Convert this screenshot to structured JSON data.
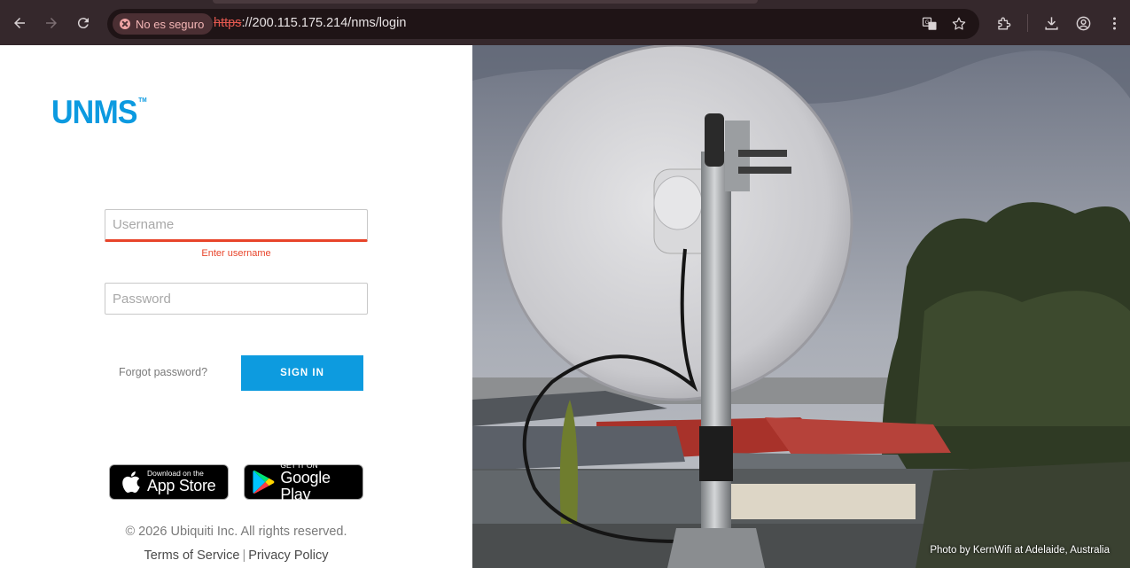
{
  "browser": {
    "security_chip": "No es seguro",
    "url_scheme": "https",
    "url_rest": "://200.115.175.214/nms/login"
  },
  "login": {
    "logo": "UNMS",
    "logo_tm": "TM",
    "username_placeholder": "Username",
    "username_error": "Enter username",
    "password_placeholder": "Password",
    "forgot_label": "Forgot password?",
    "signin_label": "SIGN IN"
  },
  "stores": {
    "app_store_small": "Download on the",
    "app_store_big": "App Store",
    "google_play_small": "GET IT ON",
    "google_play_big": "Google Play"
  },
  "footer": {
    "copyright": "© 2026 Ubiquiti Inc. All rights reserved.",
    "terms": "Terms of Service",
    "separator": "|",
    "privacy": "Privacy Policy"
  },
  "photo": {
    "credit": "Photo by KernWifi at Adelaide, Australia"
  },
  "colors": {
    "brand": "#0c9ae0",
    "error": "#e8442a",
    "chrome": "#35282c"
  }
}
